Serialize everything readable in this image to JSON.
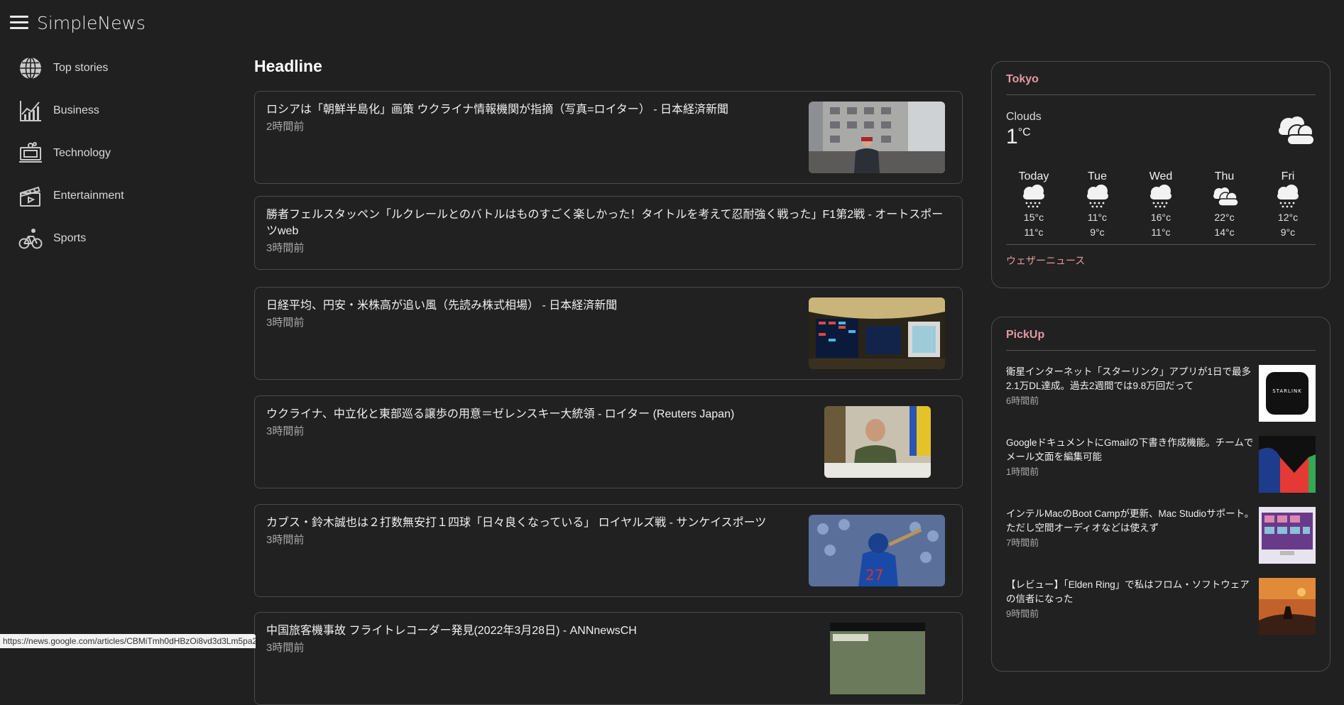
{
  "app": {
    "title": "SimpleNews"
  },
  "sidebar": {
    "items": [
      {
        "label": "Top stories",
        "icon": "globe-icon"
      },
      {
        "label": "Business",
        "icon": "chart-icon"
      },
      {
        "label": "Technology",
        "icon": "computer-icon"
      },
      {
        "label": "Entertainment",
        "icon": "clapperboard-icon"
      },
      {
        "label": "Sports",
        "icon": "bicycle-icon"
      }
    ]
  },
  "main": {
    "title": "Headline",
    "articles": [
      {
        "title": "ロシアは「朝鮮半島化」画策 ウクライナ情報機関が指摘（写真=ロイター） - 日本経済新聞",
        "time": "2時間前"
      },
      {
        "title": "勝者フェルスタッペン「ルクレールとのバトルはものすごく楽しかった！タイトルを考えて忍耐強く戦った」F1第2戦 - オートスポーツweb",
        "time": "3時間前"
      },
      {
        "title": "日経平均、円安・米株高が追い風（先読み株式相場） - 日本経済新聞",
        "time": "3時間前"
      },
      {
        "title": "ウクライナ、中立化と東部巡る譲歩の用意＝ゼレンスキー大統領 - ロイター (Reuters Japan)",
        "time": "3時間前"
      },
      {
        "title": "カブス・鈴木誠也は２打数無安打１四球「日々良くなっている」 ロイヤルズ戦 - サンケイスポーツ",
        "time": "3時間前"
      },
      {
        "title": "中国旅客機事故 フライトレコーダー発見(2022年3月28日) - ANNnewsCH",
        "time": "3時間前"
      }
    ]
  },
  "weather": {
    "city": "Tokyo",
    "condition": "Clouds",
    "temp": "1",
    "unit": "°C",
    "forecast": [
      {
        "day": "Today",
        "high": "15°c",
        "low": "11°c",
        "icon": "snow-icon"
      },
      {
        "day": "Tue",
        "high": "11°c",
        "low": "9°c",
        "icon": "snow-icon"
      },
      {
        "day": "Wed",
        "high": "16°c",
        "low": "11°c",
        "icon": "snow-icon"
      },
      {
        "day": "Thu",
        "high": "22°c",
        "low": "14°c",
        "icon": "clouds-icon"
      },
      {
        "day": "Fri",
        "high": "12°c",
        "low": "9°c",
        "icon": "snow-icon"
      }
    ],
    "link": "ウェザーニュース"
  },
  "pickup": {
    "title": "PickUp",
    "items": [
      {
        "title": "衛星インターネット「スターリンク」アプリが1日で最多2.1万DL達成。過去2週間では9.8万回だって",
        "time": "6時間前",
        "thumb_text": "STARLINK"
      },
      {
        "title": "GoogleドキュメントにGmailの下書き作成機能。チームでメール文面を編集可能",
        "time": "1時間前"
      },
      {
        "title": "インテルMacのBoot Campが更新、Mac Studioサポート。ただし空間オーディオなどは使えず",
        "time": "7時間前"
      },
      {
        "title": "【レビュー】「Elden Ring」で私はフロム・ソフトウェアの信者になった",
        "time": "9時間前"
      }
    ]
  },
  "status": {
    "url": "https://news.google.com/articles/CBMiTmh0dHBzOi8vd3d3Lm5pa2tlaS5jb20vYXJ0aWNsZS9ER1haUVdT"
  },
  "colors": {
    "background": "#202020",
    "accent": "#e29aa0",
    "border": "#4a4a4a"
  }
}
